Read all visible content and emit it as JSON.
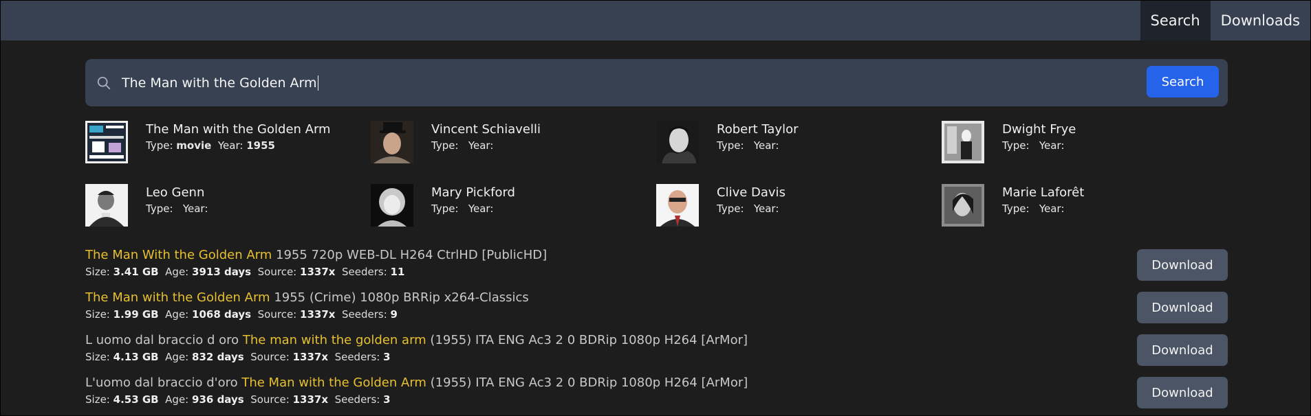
{
  "nav": {
    "search_label": "Search",
    "downloads_label": "Downloads"
  },
  "search": {
    "query": "The Man with the Golden Arm",
    "button_label": "Search",
    "icon": "search-icon"
  },
  "results": [
    {
      "title": "The Man with the Golden Arm",
      "type_label": "Type:",
      "type": "movie",
      "year_label": "Year:",
      "year": "1955"
    },
    {
      "title": "Vincent Schiavelli",
      "type_label": "Type:",
      "type": "",
      "year_label": "Year:",
      "year": ""
    },
    {
      "title": "Robert Taylor",
      "type_label": "Type:",
      "type": "",
      "year_label": "Year:",
      "year": ""
    },
    {
      "title": "Dwight Frye",
      "type_label": "Type:",
      "type": "",
      "year_label": "Year:",
      "year": ""
    },
    {
      "title": "Leo Genn",
      "type_label": "Type:",
      "type": "",
      "year_label": "Year:",
      "year": ""
    },
    {
      "title": "Mary Pickford",
      "type_label": "Type:",
      "type": "",
      "year_label": "Year:",
      "year": ""
    },
    {
      "title": "Clive Davis",
      "type_label": "Type:",
      "type": "",
      "year_label": "Year:",
      "year": ""
    },
    {
      "title": "Marie Laforêt",
      "type_label": "Type:",
      "type": "",
      "year_label": "Year:",
      "year": ""
    }
  ],
  "torrents": [
    {
      "prefix": "",
      "highlight": "The Man With the Golden Arm",
      "suffix": " 1955 720p WEB-DL H264 CtrlHD [PublicHD]",
      "size_label": "Size:",
      "size": "3.41 GB",
      "age_label": "Age:",
      "age": "3913 days",
      "source_label": "Source:",
      "source": "1337x",
      "seeders_label": "Seeders:",
      "seeders": "11",
      "button_label": "Download"
    },
    {
      "prefix": "",
      "highlight": "The Man with the Golden Arm",
      "suffix": " 1955 (Crime) 1080p BRRip x264-Classics",
      "size_label": "Size:",
      "size": "1.99 GB",
      "age_label": "Age:",
      "age": "1068 days",
      "source_label": "Source:",
      "source": "1337x",
      "seeders_label": "Seeders:",
      "seeders": "9",
      "button_label": "Download"
    },
    {
      "prefix": "L uomo dal braccio d oro ",
      "highlight": "The man with the golden arm",
      "suffix": " (1955) ITA ENG Ac3 2 0 BDRip 1080p H264 [ArMor]",
      "size_label": "Size:",
      "size": "4.13 GB",
      "age_label": "Age:",
      "age": "832 days",
      "source_label": "Source:",
      "source": "1337x",
      "seeders_label": "Seeders:",
      "seeders": "3",
      "button_label": "Download"
    },
    {
      "prefix": "L'uomo dal braccio d'oro ",
      "highlight": "The Man with the Golden Arm",
      "suffix": " (1955) ITA ENG Ac3 2 0 BDRip 1080p H264 [ArMor]",
      "size_label": "Size:",
      "size": "4.53 GB",
      "age_label": "Age:",
      "age": "936 days",
      "source_label": "Source:",
      "source": "1337x",
      "seeders_label": "Seeders:",
      "seeders": "3",
      "button_label": "Download"
    }
  ],
  "colors": {
    "topbar": "#384152",
    "background": "#1d1d1d",
    "accent": "#2563eb",
    "highlight": "#e6c02f",
    "download_button": "#4b5565"
  }
}
